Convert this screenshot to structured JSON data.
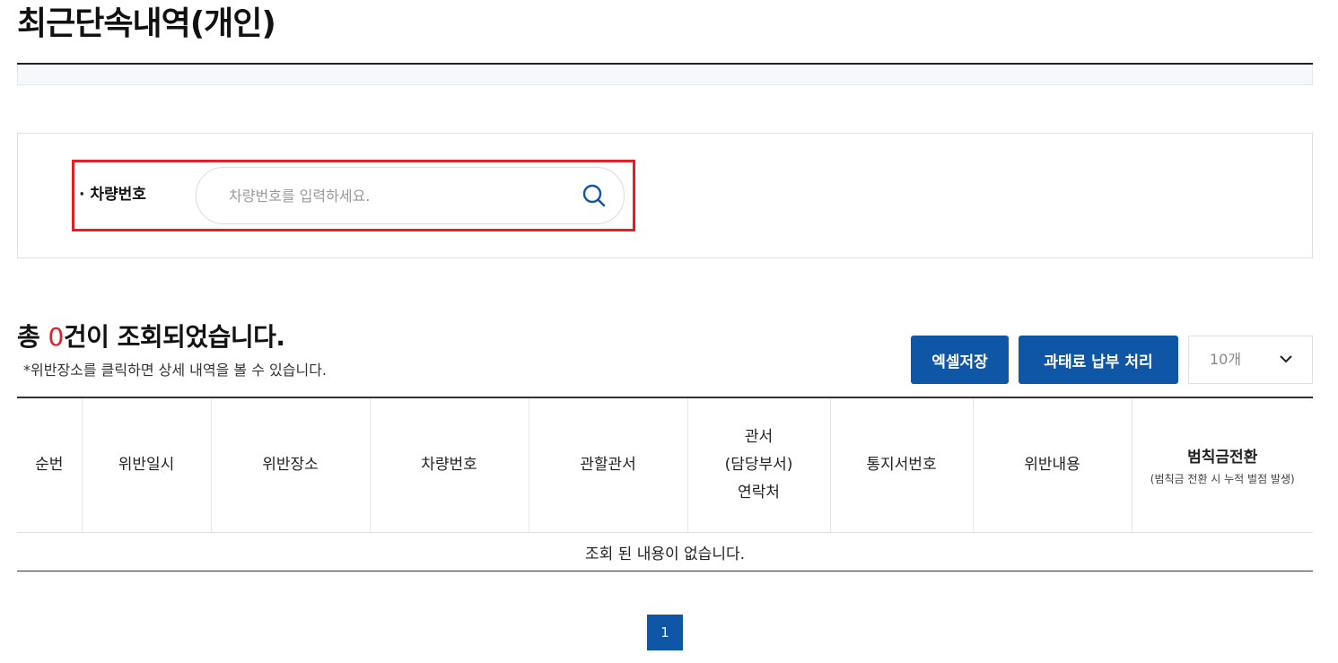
{
  "page": {
    "title": "최근단속내역(개인)"
  },
  "search": {
    "label": "· 차량번호",
    "placeholder": "차량번호를 입력하세요.",
    "value": ""
  },
  "results": {
    "prefix": "총 ",
    "count": "0",
    "suffix": "건이 조회되었습니다.",
    "note": "*위반장소를 클릭하면 상세 내역을 볼 수 있습니다."
  },
  "actions": {
    "excel_label": "엑셀저장",
    "pay_label": "과태료 납부 처리",
    "page_size": "10개"
  },
  "table": {
    "headers": {
      "no": "순번",
      "datetime": "위반일시",
      "place": "위반장소",
      "car_no": "차량번호",
      "office": "관할관서",
      "contact_line1": "관서",
      "contact_line2": "(담당부서)",
      "contact_line3": "연락처",
      "notice_no": "통지서번호",
      "violation": "위반내용",
      "convert_main": "범칙금전환",
      "convert_sub": "(범칙금 전환 시 누적 벌점 발생)"
    },
    "empty_message": "조회 된 내용이 없습니다."
  },
  "pagination": {
    "current": "1"
  },
  "colors": {
    "primary": "#0f56a6",
    "highlight": "#e41e26",
    "count": "#e41e26"
  },
  "icons": {
    "search": "search-icon",
    "chevron": "chevron-down-icon"
  }
}
